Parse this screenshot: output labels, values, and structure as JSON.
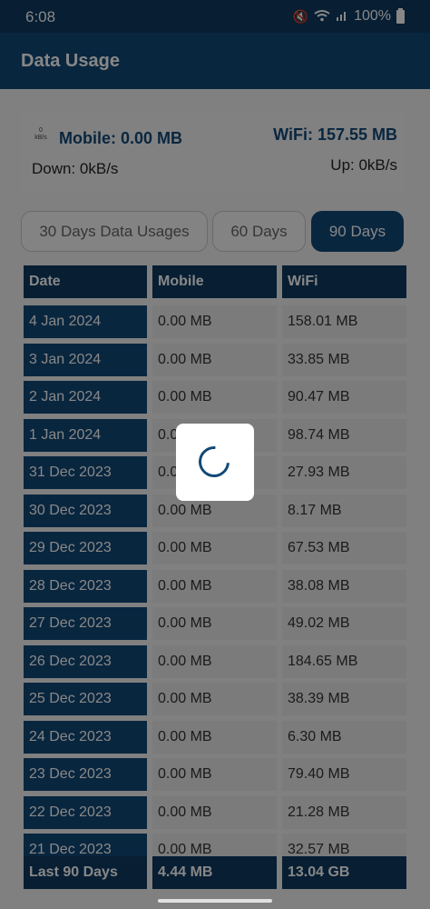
{
  "status_bar": {
    "time": "6:08",
    "battery": "100%"
  },
  "app": {
    "title": "Data Usage"
  },
  "summary": {
    "speed_mini_top": "0",
    "speed_mini_bottom": "kB/s",
    "mobile": "Mobile: 0.00 MB",
    "wifi": "WiFi: 157.55 MB",
    "down": "Down: 0kB/s",
    "up": "Up: 0kB/s"
  },
  "tabs": [
    {
      "label": "30 Days Data Usages",
      "active": false
    },
    {
      "label": "60 Days",
      "active": false
    },
    {
      "label": "90 Days",
      "active": true
    }
  ],
  "table": {
    "headers": [
      "Date",
      "Mobile",
      "WiFi"
    ],
    "rows": [
      {
        "date": "4 Jan 2024",
        "mobile": "0.00 MB",
        "wifi": "158.01 MB"
      },
      {
        "date": "3 Jan 2024",
        "mobile": "0.00 MB",
        "wifi": "33.85 MB"
      },
      {
        "date": "2 Jan 2024",
        "mobile": "0.00 MB",
        "wifi": "90.47 MB"
      },
      {
        "date": "1 Jan 2024",
        "mobile": "0.0",
        "wifi": "98.74 MB"
      },
      {
        "date": "31 Dec 2023",
        "mobile": "0.0",
        "wifi": "27.93 MB"
      },
      {
        "date": "30 Dec 2023",
        "mobile": "0.00 MB",
        "wifi": "8.17 MB"
      },
      {
        "date": "29 Dec 2023",
        "mobile": "0.00 MB",
        "wifi": "67.53 MB"
      },
      {
        "date": "28 Dec 2023",
        "mobile": "0.00 MB",
        "wifi": "38.08 MB"
      },
      {
        "date": "27 Dec 2023",
        "mobile": "0.00 MB",
        "wifi": "49.02 MB"
      },
      {
        "date": "26 Dec 2023",
        "mobile": "0.00 MB",
        "wifi": "184.65 MB"
      },
      {
        "date": "25 Dec 2023",
        "mobile": "0.00 MB",
        "wifi": "38.39 MB"
      },
      {
        "date": "24 Dec 2023",
        "mobile": "0.00 MB",
        "wifi": "6.30 MB"
      },
      {
        "date": "23 Dec 2023",
        "mobile": "0.00 MB",
        "wifi": "79.40 MB"
      },
      {
        "date": "22 Dec 2023",
        "mobile": "0.00 MB",
        "wifi": "21.28 MB"
      },
      {
        "date": "21 Dec 2023",
        "mobile": "0.00 MB",
        "wifi": "32.57 MB"
      }
    ],
    "footer": {
      "label": "Last 90 Days",
      "mobile": "4.44 MB",
      "wifi": "13.04 GB"
    }
  },
  "colors": {
    "primary": "#124877",
    "header": "#0f3a60",
    "cell_bg": "#e9e9e9",
    "overlay": "rgba(0,0,0,0.47)"
  },
  "icons": [
    "mute-icon",
    "wifi-icon",
    "signal-icon",
    "battery-icon",
    "loading-spinner-icon",
    "speed-meter-icon"
  ]
}
